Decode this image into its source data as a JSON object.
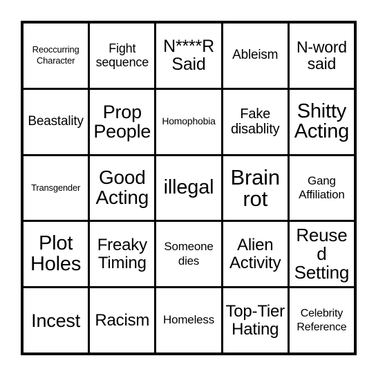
{
  "card": {
    "type": "bingo-card",
    "grid_size": "5x5",
    "background_color": "#ffffff",
    "border_color": "#000000",
    "text_color": "#000000",
    "rows": [
      {
        "index": 1,
        "cells": [
          {
            "text": "Reoccurring Character",
            "size": "fs-xs"
          },
          {
            "text": "Fight sequence",
            "size": "fs-m"
          },
          {
            "text": "N****R Said",
            "size": "fs-l3"
          },
          {
            "text": "Ableism",
            "size": "fs-m2"
          },
          {
            "text": "N-word said",
            "size": "fs-l"
          }
        ]
      },
      {
        "index": 2,
        "cells": [
          {
            "text": "Beastality",
            "size": "fs-m2"
          },
          {
            "text": "Prop People",
            "size": "fs-xl2"
          },
          {
            "text": "Homophobia",
            "size": "fs-xs2"
          },
          {
            "text": "Fake disablity",
            "size": "fs-m3"
          },
          {
            "text": "Shitty Acting",
            "size": "fs-xxl"
          }
        ]
      },
      {
        "index": 3,
        "cells": [
          {
            "text": "Transgender",
            "size": "fs-xs"
          },
          {
            "text": "Good Acting",
            "size": "fs-xl3"
          },
          {
            "text": "illegal",
            "size": "fs-xxl"
          },
          {
            "text": "Brain rot",
            "size": "fs-xxxl"
          },
          {
            "text": "Gang Affiliation",
            "size": "fs-s2"
          }
        ]
      },
      {
        "index": 4,
        "cells": [
          {
            "text": "Plot Holes",
            "size": "fs-xxl"
          },
          {
            "text": "Freaky Timing",
            "size": "fs-l2"
          },
          {
            "text": "Someone dies",
            "size": "fs-s2"
          },
          {
            "text": "Alien Activity",
            "size": "fs-l2"
          },
          {
            "text": "Reused Setting",
            "size": "fs-xl"
          }
        ]
      },
      {
        "index": 5,
        "cells": [
          {
            "text": "Incest",
            "size": "fs-xl2"
          },
          {
            "text": "Racism",
            "size": "fs-l2"
          },
          {
            "text": "Homeless",
            "size": "fs-s2"
          },
          {
            "text": "Top-Tier Hating",
            "size": "fs-l2"
          },
          {
            "text": "Celebrity Reference",
            "size": "fs-s"
          }
        ]
      }
    ]
  }
}
